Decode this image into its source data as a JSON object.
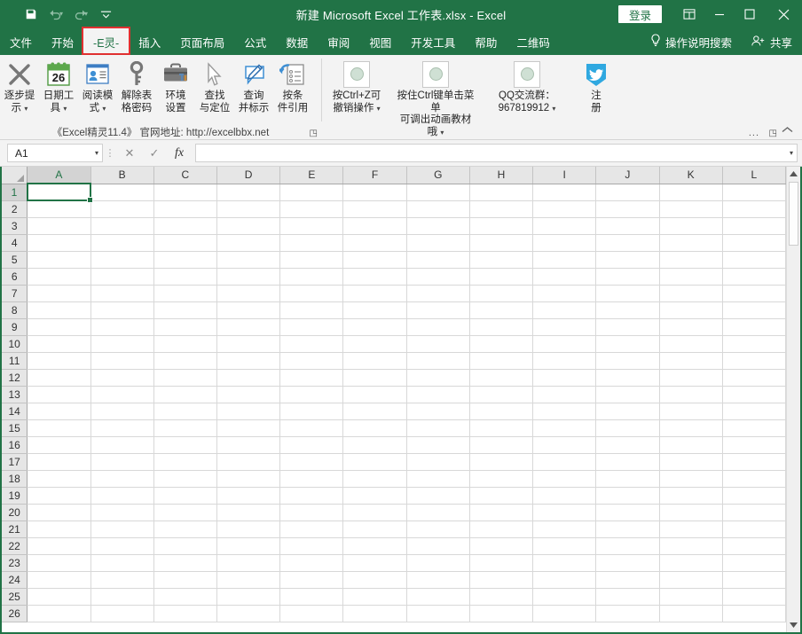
{
  "window": {
    "title": "新建 Microsoft Excel 工作表.xlsx  -  Excel",
    "signin_label": "登录",
    "ribbon_display_icon": "ribbon-display-options-icon",
    "minimize_label": "—",
    "maximize_label": "☐",
    "close_label": "✕",
    "accent_green": "#217346"
  },
  "quick_access": {
    "items": [
      {
        "name": "save-icon",
        "label": "保存"
      },
      {
        "name": "undo-icon",
        "label": "撤销"
      },
      {
        "name": "redo-icon",
        "label": "恢复"
      },
      {
        "name": "customize-quick-access-icon",
        "label": "自定义快速访问工具栏"
      }
    ]
  },
  "tabs": {
    "left": [
      {
        "label": "文件",
        "active": false
      },
      {
        "label": "开始",
        "active": false
      },
      {
        "label": "-E灵-",
        "active": true,
        "highlighted": true
      },
      {
        "label": "插入",
        "active": false
      },
      {
        "label": "页面布局",
        "active": false
      },
      {
        "label": "公式",
        "active": false
      },
      {
        "label": "数据",
        "active": false
      },
      {
        "label": "审阅",
        "active": false
      },
      {
        "label": "视图",
        "active": false
      },
      {
        "label": "开发工具",
        "active": false
      },
      {
        "label": "帮助",
        "active": false
      },
      {
        "label": "二维码",
        "active": false
      }
    ],
    "tellme": {
      "icon": "lightbulb-icon",
      "label": "操作说明搜索"
    },
    "share": {
      "icon": "share-person-icon",
      "label": "共享"
    }
  },
  "ribbon": {
    "group1": {
      "label": "《Excel精灵11.4》  官网地址: http://excelbbx.net",
      "buttons": [
        {
          "icon": "close-x-icon",
          "line1": "逐步提",
          "line2": "示",
          "dropdown": true
        },
        {
          "icon": "calendar-26-icon",
          "line1": "日期工",
          "line2": "具",
          "dropdown": true
        },
        {
          "icon": "contact-card-icon",
          "line1": "阅读模",
          "line2": "式",
          "dropdown": true
        },
        {
          "icon": "key-icon",
          "line1": "解除表",
          "line2": "格密码",
          "dropdown": false
        },
        {
          "icon": "toolbox-icon",
          "line1": "环境",
          "line2": "设置",
          "dropdown": false
        },
        {
          "icon": "cursor-arrow-icon",
          "line1": "查找",
          "line2": "与定位",
          "dropdown": false
        },
        {
          "icon": "pencil-comment-icon",
          "line1": "查询",
          "line2": "并标示",
          "dropdown": false
        },
        {
          "icon": "list-undo-icon",
          "line1": "按条",
          "line2": "件引用",
          "dropdown": false
        }
      ]
    },
    "group2": {
      "buttons": [
        {
          "icon": "placeholder-circle-icon",
          "line1": "按Ctrl+Z可",
          "line2": "撤销操作",
          "dropdown": true
        },
        {
          "icon": "placeholder-circle-icon",
          "line1": "按住Ctrl键单击菜单",
          "line2": "可调出动画教材哦",
          "dropdown": true
        },
        {
          "icon": "placeholder-circle-icon",
          "line1": "QQ交流群：",
          "line2": "967819912",
          "dropdown": true
        },
        {
          "icon": "twitter-bird-icon",
          "line1": "注",
          "line2": "册",
          "dropdown": false
        }
      ],
      "ellipsis": "...",
      "launcher": "↘"
    },
    "collapse_icon": "collapse-ribbon-chevron-icon"
  },
  "formula_bar": {
    "name_box_value": "A1",
    "name_box_dropdown": "▾",
    "cancel_icon": "✕",
    "enter_icon": "✓",
    "function_icon": "fx",
    "input_value": "",
    "expand_dropdown": "▾"
  },
  "grid": {
    "columns": [
      "A",
      "B",
      "C",
      "D",
      "E",
      "F",
      "G",
      "H",
      "I",
      "J",
      "K",
      "L"
    ],
    "rows": [
      1,
      2,
      3,
      4,
      5,
      6,
      7,
      8,
      9,
      10,
      11,
      12,
      13,
      14,
      15,
      16,
      17,
      18,
      19,
      20,
      21,
      22,
      23,
      24,
      25,
      26
    ],
    "selected_cell": "A1",
    "selected_column": "A",
    "selected_row": 1
  },
  "scrollbar": {
    "up_arrow": "▲",
    "down_arrow": "▼"
  }
}
